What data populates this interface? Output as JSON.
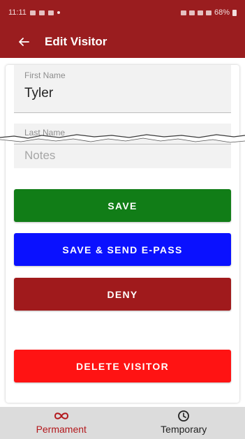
{
  "status_bar": {
    "time": "11:11",
    "battery": "68%"
  },
  "app_bar": {
    "back_icon": "arrow-left-icon",
    "title": "Edit Visitor"
  },
  "form": {
    "first_name": {
      "label": "First Name",
      "value": "Tyler"
    },
    "last_name": {
      "label": "Last Name"
    },
    "notes": {
      "placeholder": "Notes"
    }
  },
  "buttons": {
    "save": "SAVE",
    "save_send": "SAVE & SEND E-PASS",
    "deny": "DENY",
    "delete": "DELETE VISITOR"
  },
  "bottom_nav": {
    "tabs": [
      {
        "label": "Permament",
        "icon": "infinity-icon",
        "active": true
      },
      {
        "label": "Temporary",
        "icon": "clock-icon",
        "active": false
      }
    ]
  },
  "colors": {
    "primary": "#9a1d1f",
    "save": "#117d17",
    "send": "#0a11ff",
    "deny": "#a01a1c",
    "delete": "#ff1313",
    "nav_active": "#b3181c"
  }
}
